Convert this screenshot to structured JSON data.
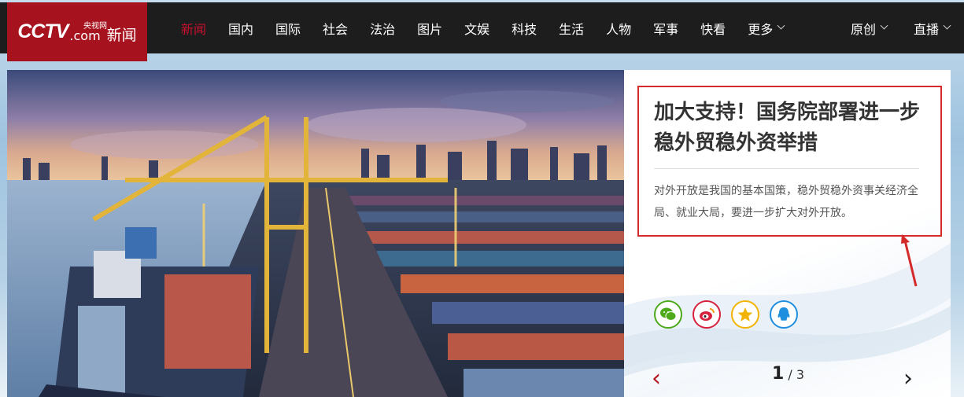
{
  "header": {
    "logo": {
      "cctv": "CCTV",
      "com": ".com",
      "yangshi": "央视网",
      "xinwen": "新闻"
    },
    "nav": [
      {
        "label": "新闻",
        "active": true
      },
      {
        "label": "国内"
      },
      {
        "label": "国际"
      },
      {
        "label": "社会"
      },
      {
        "label": "法治"
      },
      {
        "label": "图片"
      },
      {
        "label": "文娱"
      },
      {
        "label": "科技"
      },
      {
        "label": "生活"
      },
      {
        "label": "人物"
      },
      {
        "label": "军事"
      },
      {
        "label": "快看"
      },
      {
        "label": "更多",
        "dropdown": true
      }
    ],
    "nav_right": [
      {
        "label": "原创",
        "dropdown": true
      },
      {
        "label": "直播",
        "dropdown": true
      }
    ],
    "colors": {
      "bar": "#1d1d1d",
      "brand": "#a7121f",
      "active": "#c8102e"
    }
  },
  "feature": {
    "headline": "加大支持！国务院部署进一步稳外贸稳外资举措",
    "summary": "对外开放是我国的基本国策，稳外贸稳外资事关经济全局、就业大局，要进一步扩大对外开放。",
    "share_icons": [
      "wechat-icon",
      "weibo-icon",
      "favorite-star-icon",
      "qq-icon"
    ],
    "pager": {
      "current": "1",
      "separator": "/",
      "total": "3",
      "prev": "‹",
      "next": "›"
    },
    "highlight_color": "#d42a2a"
  }
}
